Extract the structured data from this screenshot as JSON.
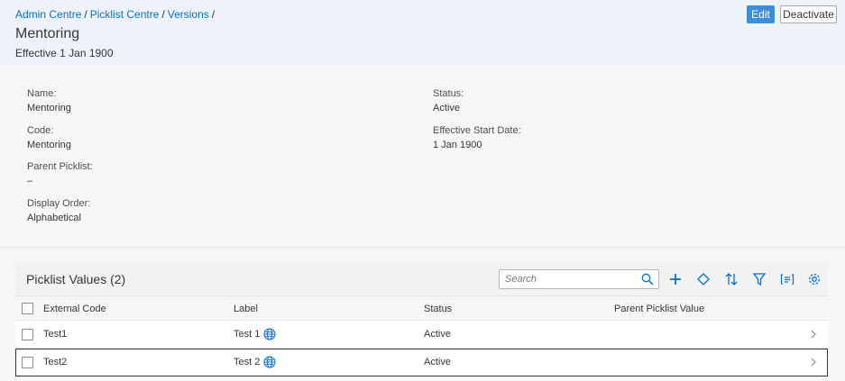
{
  "header": {
    "breadcrumb": [
      {
        "label": "Admin Centre"
      },
      {
        "label": "Picklist Centre"
      },
      {
        "label": "Versions"
      }
    ],
    "separator": "/",
    "title": "Mentoring",
    "subtitle": "Effective 1 Jan 1900",
    "actions": {
      "edit_label": "Edit",
      "deactivate_label": "Deactivate"
    }
  },
  "details": {
    "name": {
      "label": "Name:",
      "value": "Mentoring"
    },
    "code": {
      "label": "Code:",
      "value": "Mentoring"
    },
    "parent_picklist": {
      "label": "Parent Picklist:",
      "value": "–"
    },
    "display_order": {
      "label": "Display Order:",
      "value": "Alphabetical"
    },
    "status": {
      "label": "Status:",
      "value": "Active"
    },
    "effective_start_date": {
      "label": "Effective Start Date:",
      "value": "1 Jan 1900"
    }
  },
  "picklist_values": {
    "title": "Picklist Values (2)",
    "search_placeholder": "Search",
    "toolbar_icons": [
      "add-icon",
      "diamond-icon",
      "sort-icon",
      "filter-icon",
      "group-icon",
      "settings-icon"
    ],
    "columns": {
      "external_code": "External Code",
      "label": "Label",
      "status": "Status",
      "parent_value": "Parent Picklist Value"
    },
    "rows": [
      {
        "external_code": "Test1",
        "label": "Test 1",
        "status": "Active",
        "parent_value": ""
      },
      {
        "external_code": "Test2",
        "label": "Test 2",
        "status": "Active",
        "parent_value": ""
      }
    ]
  },
  "colors": {
    "accent": "#0a6ed1",
    "edit_button": "#3b8ed7",
    "header_bg": "#edf3f8",
    "globe": "#0a6ed1"
  }
}
